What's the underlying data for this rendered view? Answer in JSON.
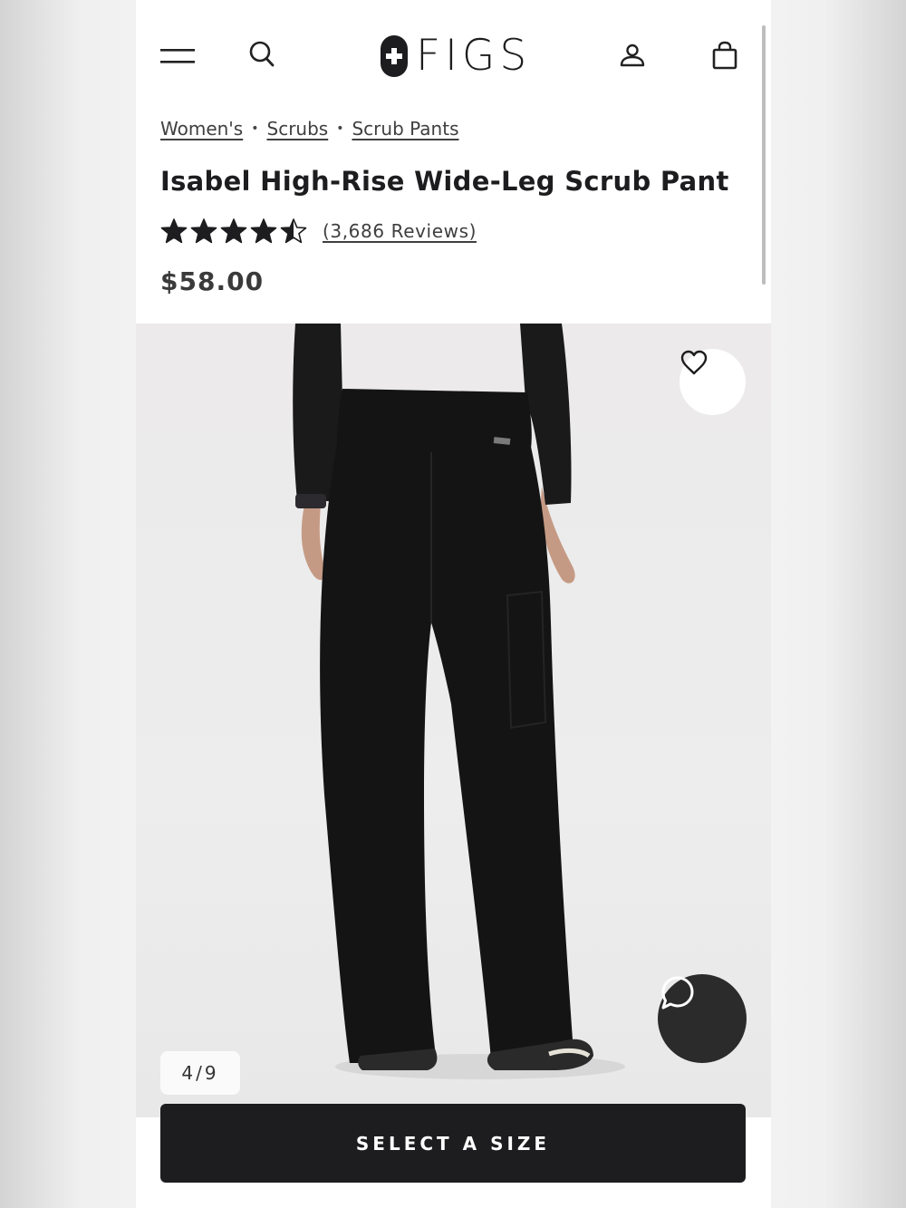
{
  "header": {
    "logo_text": "FIGS",
    "icons": [
      "menu-icon",
      "search-icon",
      "account-icon",
      "bag-icon"
    ]
  },
  "breadcrumb": {
    "items": [
      "Women's",
      "Scrubs",
      "Scrub Pants"
    ],
    "separator": "•"
  },
  "product": {
    "title": "Isabel High-Rise Wide-Leg Scrub Pant",
    "rating": 4.5,
    "reviews_label": "(3,686 Reviews)",
    "price": "$58.00"
  },
  "gallery": {
    "counter": "4/9",
    "favorite_icon": "heart-icon",
    "chat_icon": "chat-bubble-icon"
  },
  "cta": {
    "label": "SELECT A SIZE"
  },
  "colors": {
    "primary_dark": "#1d1d1f",
    "text_gray": "#3f3f3f",
    "image_bg": "#ededed"
  }
}
